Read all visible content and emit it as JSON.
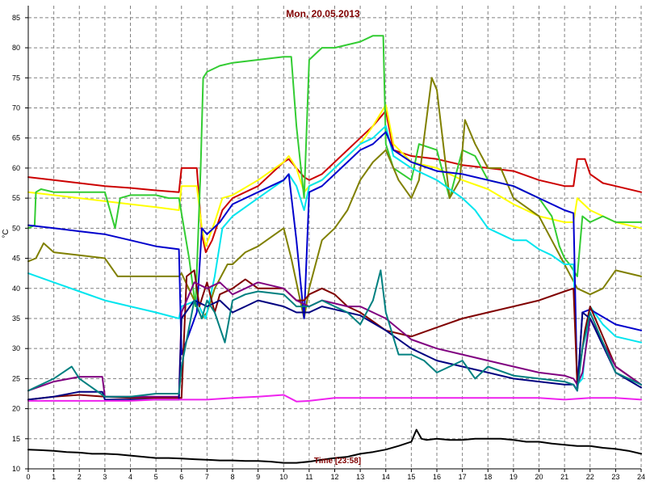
{
  "chart_data": {
    "type": "line",
    "title": "Mon, 20.05.2013",
    "ylabel": "°C",
    "xlabel": "Time [23:58]",
    "xlim": [
      0,
      24
    ],
    "ylim": [
      10,
      87
    ],
    "x_ticks": [
      0,
      1,
      2,
      3,
      4,
      5,
      6,
      7,
      8,
      9,
      10,
      11,
      12,
      13,
      14,
      15,
      16,
      17,
      18,
      19,
      20,
      21,
      22,
      23,
      24
    ],
    "y_ticks": [
      10,
      15,
      20,
      25,
      30,
      35,
      40,
      45,
      50,
      55,
      60,
      65,
      70,
      75,
      80,
      85
    ],
    "grid": true,
    "series": [
      {
        "color": "#cc0000",
        "x": [
          0,
          1,
          2,
          3,
          4,
          5,
          5.9,
          6,
          6.6,
          6.8,
          6.95,
          7.2,
          7.6,
          8,
          9,
          10,
          10.2,
          10.5,
          10.8,
          11,
          11.5,
          12,
          13,
          13.5,
          14,
          14.3,
          15,
          16,
          17,
          18,
          19,
          20,
          21,
          21.35,
          21.5,
          21.8,
          22,
          22.5,
          23,
          24
        ],
        "y": [
          58.5,
          58,
          57.5,
          57,
          56.7,
          56.3,
          56,
          60,
          60,
          49,
          46,
          48,
          53,
          55,
          57,
          61,
          61.5,
          60,
          58.5,
          58,
          59,
          61,
          65,
          67,
          69.5,
          63,
          62,
          61.5,
          60.5,
          60,
          59.5,
          58,
          57,
          57,
          61.5,
          61.5,
          59,
          57.5,
          57,
          56
        ]
      },
      {
        "color": "#ffff00",
        "x": [
          0,
          1,
          2,
          3,
          4,
          5,
          5.9,
          6,
          6.6,
          6.8,
          6.95,
          7.3,
          7.6,
          8,
          9,
          10,
          10.2,
          10.5,
          10.8,
          11,
          11.5,
          12,
          13,
          13.5,
          14,
          14.3,
          15,
          16,
          17,
          18,
          19,
          20,
          21,
          21.35,
          21.5,
          22,
          23,
          24
        ],
        "y": [
          56,
          55.5,
          55,
          54.5,
          54,
          53.5,
          53,
          57,
          57,
          50,
          47,
          51,
          55,
          55.5,
          58,
          61,
          62,
          60,
          56,
          57,
          58,
          60,
          64,
          67,
          70.5,
          64,
          61,
          60,
          58,
          56.5,
          54,
          52,
          51,
          51,
          55,
          53,
          51,
          50
        ]
      },
      {
        "color": "#33cc33",
        "x": [
          0,
          0.25,
          0.3,
          0.5,
          1,
          2,
          3,
          3.4,
          3.6,
          4,
          5,
          5.5,
          5.9,
          6.3,
          6.55,
          6.75,
          6.85,
          7,
          7.5,
          8,
          9,
          10,
          10.3,
          10.5,
          10.8,
          11,
          11.5,
          12,
          13,
          13.5,
          13.9,
          14,
          14.3,
          15,
          15.3,
          16,
          16.5,
          17,
          17.5,
          18,
          19,
          20,
          20.5,
          20.8,
          21,
          21.2,
          21.5,
          21.7,
          22,
          22.5,
          23,
          24
        ],
        "y": [
          50,
          50.5,
          56,
          56.5,
          56,
          56,
          56,
          50,
          55,
          55.5,
          55.5,
          55,
          55,
          45,
          37,
          60,
          75,
          76,
          77,
          77.5,
          78,
          78.5,
          78.5,
          67,
          55,
          78,
          80,
          80,
          81,
          82,
          82,
          64,
          60,
          58,
          64,
          63,
          55,
          63,
          62,
          58,
          57,
          55,
          52,
          47,
          45,
          44,
          42,
          52,
          51,
          52,
          51,
          51
        ]
      },
      {
        "color": "#808000",
        "x": [
          0,
          0.3,
          0.6,
          1,
          2,
          3,
          3.5,
          4,
          5,
          5.9,
          6,
          6.5,
          6.8,
          7,
          7.3,
          7.8,
          8,
          8.5,
          9,
          10,
          10.3,
          10.8,
          11,
          11.5,
          12,
          12.5,
          13,
          13.5,
          14,
          14.5,
          15,
          15.3,
          15.5,
          15.8,
          16,
          16.5,
          16.9,
          17.1,
          17.5,
          18,
          18.5,
          19,
          20,
          20.5,
          21,
          21.5,
          22,
          22.5,
          23,
          24
        ],
        "y": [
          44.5,
          45,
          47.5,
          46,
          45.5,
          45,
          42,
          42,
          42,
          42,
          42.5,
          38,
          35,
          36,
          40,
          44,
          44,
          46,
          47,
          50,
          45,
          35,
          40,
          48,
          50,
          53,
          58,
          61,
          63,
          58,
          55,
          58,
          65,
          75,
          73,
          55,
          58,
          68,
          64,
          60,
          60,
          55,
          52,
          48,
          44,
          40,
          39,
          40,
          43,
          42
        ]
      },
      {
        "color": "#00e5ee",
        "x": [
          0,
          1,
          2,
          3,
          4,
          5,
          5.9,
          6,
          6.6,
          6.8,
          6.95,
          7.3,
          7.6,
          8,
          9,
          10,
          10.2,
          10.5,
          10.8,
          11,
          11.5,
          12,
          13,
          13.5,
          14,
          14.3,
          15,
          16,
          17,
          17.5,
          18,
          19,
          19.5,
          20,
          20.5,
          21,
          21.35,
          21.5,
          21.7,
          22,
          22.5,
          23,
          24
        ],
        "y": [
          42.5,
          41,
          39.5,
          38,
          37,
          36,
          35,
          37,
          38,
          36,
          35,
          42,
          50,
          52,
          55,
          58,
          59,
          57,
          53,
          57,
          58,
          60,
          64,
          65,
          67,
          62,
          60,
          58,
          55,
          53,
          50,
          48,
          48,
          46.5,
          45.5,
          44,
          44,
          24,
          25,
          37,
          34,
          32,
          31
        ]
      },
      {
        "color": "#0000cc",
        "x": [
          0,
          1,
          2,
          3,
          4,
          5,
          5.9,
          6,
          6.6,
          6.8,
          7,
          7.5,
          8,
          9,
          10,
          10.2,
          10.5,
          10.8,
          11,
          11.5,
          12,
          13,
          13.5,
          14,
          14.3,
          15,
          16,
          17,
          18,
          19,
          20,
          21,
          21.35,
          21.5,
          21.7,
          22,
          23,
          24
        ],
        "y": [
          50.5,
          50,
          49.5,
          49,
          48,
          47,
          46.5,
          29,
          36,
          50,
          49,
          51,
          54,
          56,
          58,
          59,
          48,
          35,
          56,
          57,
          59,
          63,
          64,
          66,
          63,
          61,
          59.5,
          59,
          58,
          57,
          55,
          53,
          52.5,
          23,
          36,
          36.5,
          34,
          33
        ]
      },
      {
        "color": "#800000",
        "x": [
          0,
          1,
          2,
          3,
          4,
          5,
          6,
          6.2,
          6.5,
          6.7,
          7,
          7.3,
          7.5,
          8,
          8.5,
          9,
          10,
          10.5,
          10.8,
          11,
          11.5,
          12,
          12.5,
          13,
          14,
          15,
          16,
          17,
          18,
          19,
          20,
          21,
          21.35,
          21.5,
          21.8,
          22,
          23,
          24
        ],
        "y": [
          21.5,
          22,
          22.3,
          22,
          21.8,
          21.8,
          21.8,
          42,
          43,
          37,
          41,
          36,
          39,
          40,
          41.5,
          40,
          40,
          38,
          38,
          39,
          40,
          39,
          37,
          36,
          33,
          32,
          33.5,
          35,
          36,
          37,
          38,
          39.5,
          40,
          24,
          33,
          37,
          27,
          24
        ]
      },
      {
        "color": "#800080",
        "x": [
          0,
          1,
          2,
          2.9,
          3,
          4,
          5,
          5.9,
          6,
          6.5,
          7,
          7.5,
          8,
          8.5,
          9,
          10,
          10.5,
          11,
          11.5,
          12,
          12.5,
          13,
          14,
          15,
          16,
          17,
          18,
          19,
          20,
          21,
          21.35,
          21.5,
          21.7,
          22,
          23,
          24
        ],
        "y": [
          23,
          24.5,
          25.3,
          25.3,
          22,
          22,
          22,
          22,
          36,
          41,
          40,
          41,
          39,
          40,
          41,
          40,
          38,
          37,
          38,
          37.5,
          37,
          37,
          35,
          31.5,
          30,
          29,
          28,
          27,
          26,
          25.5,
          25,
          24,
          26,
          35,
          27,
          24
        ]
      },
      {
        "color": "#000080",
        "x": [
          0,
          1,
          2,
          2.9,
          3,
          4,
          5,
          5.9,
          6,
          6.5,
          7,
          7.5,
          8,
          8.5,
          9,
          10,
          10.5,
          11,
          11.5,
          12,
          12.5,
          13,
          14,
          15,
          16,
          17,
          18,
          19,
          20,
          21,
          21.35,
          21.5,
          21.7,
          22,
          23,
          24
        ],
        "y": [
          21.5,
          22,
          22.8,
          22.8,
          21.5,
          21.5,
          21.5,
          21.5,
          35,
          38,
          37,
          38,
          36,
          37,
          38,
          37,
          36,
          36,
          37,
          36.5,
          36,
          35.5,
          33,
          30,
          28,
          27,
          26,
          25,
          24.5,
          24,
          24,
          23,
          36,
          35,
          26,
          23.5
        ]
      },
      {
        "color": "#008080",
        "x": [
          0,
          1,
          1.7,
          2,
          3,
          4,
          5,
          5.9,
          6,
          6.5,
          6.8,
          7,
          7.3,
          7.7,
          8,
          8.5,
          9,
          10,
          10.5,
          11,
          11.5,
          12,
          12.5,
          13,
          13.5,
          13.8,
          14,
          14.5,
          15,
          15.5,
          16,
          16.5,
          17,
          17.5,
          18,
          19,
          20,
          21,
          21.35,
          21.5,
          21.7,
          22,
          23,
          24
        ],
        "y": [
          23,
          25,
          27,
          25,
          22,
          22,
          22.5,
          22.5,
          27,
          38,
          35,
          38,
          36,
          31,
          38,
          39,
          39.5,
          39,
          37,
          37,
          38,
          37,
          36,
          34,
          38,
          43,
          36,
          29,
          29,
          28,
          26,
          27,
          28,
          25,
          27,
          25.5,
          25,
          24.5,
          24,
          23,
          30,
          36,
          26,
          24
        ]
      },
      {
        "color": "#ee22ee",
        "x": [
          0,
          1,
          2,
          3,
          4,
          5,
          6,
          7,
          8,
          9,
          10,
          10.5,
          11,
          12,
          13,
          14,
          15,
          16,
          17,
          18,
          19,
          20,
          21,
          22,
          23,
          24
        ],
        "y": [
          21.3,
          21.3,
          21.3,
          21.3,
          21.3,
          21.5,
          21.5,
          21.5,
          21.8,
          22,
          22.3,
          21.2,
          21.3,
          21.8,
          21.8,
          21.8,
          21.8,
          21.8,
          21.8,
          21.8,
          21.8,
          21.8,
          21.5,
          21.8,
          21.8,
          21.5
        ]
      },
      {
        "color": "#000000",
        "x": [
          0,
          0.5,
          1,
          1.5,
          2,
          2.5,
          3,
          3.5,
          4,
          4.5,
          5,
          5.5,
          6,
          6.5,
          7,
          7.5,
          8,
          8.5,
          9,
          9.5,
          10,
          10.5,
          11,
          11.5,
          12,
          12.5,
          13,
          13.5,
          14,
          14.5,
          15,
          15.2,
          15.4,
          15.6,
          16,
          16.5,
          17,
          17.5,
          18,
          18.5,
          19,
          19.5,
          20,
          20.5,
          21,
          21.5,
          22,
          22.5,
          23,
          23.5,
          24
        ],
        "y": [
          13.2,
          13.1,
          13,
          12.8,
          12.7,
          12.5,
          12.5,
          12.4,
          12.2,
          12,
          11.8,
          11.8,
          11.7,
          11.6,
          11.5,
          11.4,
          11.4,
          11.3,
          11.3,
          11.2,
          11,
          11,
          11.2,
          11.5,
          11.8,
          12,
          12.5,
          12.8,
          13.2,
          13.8,
          14.5,
          16.5,
          15,
          14.8,
          15,
          14.8,
          14.8,
          15,
          15,
          15,
          14.8,
          14.5,
          14.5,
          14.2,
          14,
          13.8,
          13.8,
          13.5,
          13.3,
          13,
          12.5
        ]
      }
    ]
  }
}
